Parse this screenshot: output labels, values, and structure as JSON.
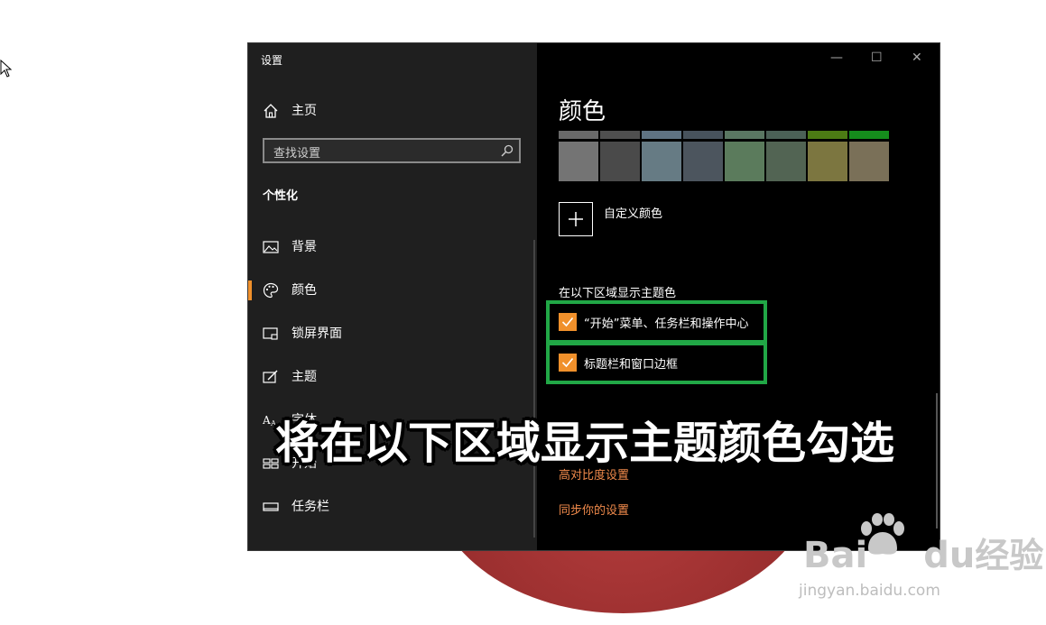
{
  "window": {
    "title": "设置",
    "controls": {
      "minimize": "—",
      "maximize": "☐",
      "close": "✕"
    }
  },
  "sidebar": {
    "home": "主页",
    "search_placeholder": "查找设置",
    "section": "个性化",
    "items": [
      {
        "label": "背景",
        "icon": "picture-icon"
      },
      {
        "label": "颜色",
        "icon": "palette-icon",
        "active": true
      },
      {
        "label": "锁屏界面",
        "icon": "lockscreen-icon"
      },
      {
        "label": "主题",
        "icon": "theme-icon"
      },
      {
        "label": "字体",
        "icon": "font-icon"
      },
      {
        "label": "开始",
        "icon": "start-icon"
      },
      {
        "label": "任务栏",
        "icon": "taskbar-icon"
      }
    ]
  },
  "content": {
    "page_title": "颜色",
    "swatches_top": [
      "#6a6a6a",
      "#4f4f4f",
      "#5f7383",
      "#47525c",
      "#5a7762",
      "#4b6156",
      "#4c7b14",
      "#158c1c"
    ],
    "swatches": [
      "#747474",
      "#4a4a4a",
      "#667b84",
      "#4c555e",
      "#5b7b5c",
      "#526453",
      "#7c7640",
      "#7a7058"
    ],
    "custom_color": "自定义颜色",
    "accent_heading": "在以下区域显示主题色",
    "checkboxes": [
      {
        "label": "“开始”菜单、任务栏和操作中心",
        "checked": true
      },
      {
        "label": "标题栏和窗口边框",
        "checked": true
      }
    ],
    "links": [
      "高对比度设置",
      "同步你的设置"
    ],
    "accent_color": "#f0902b",
    "highlight_color": "#21a746"
  },
  "overlay_caption": "将在以下区域显示主题颜色勾选",
  "watermark": {
    "brand_prefix": "Bai",
    "brand_suffix": "du",
    "brand_cn": "经验",
    "url": "jingyan.baidu.com"
  }
}
